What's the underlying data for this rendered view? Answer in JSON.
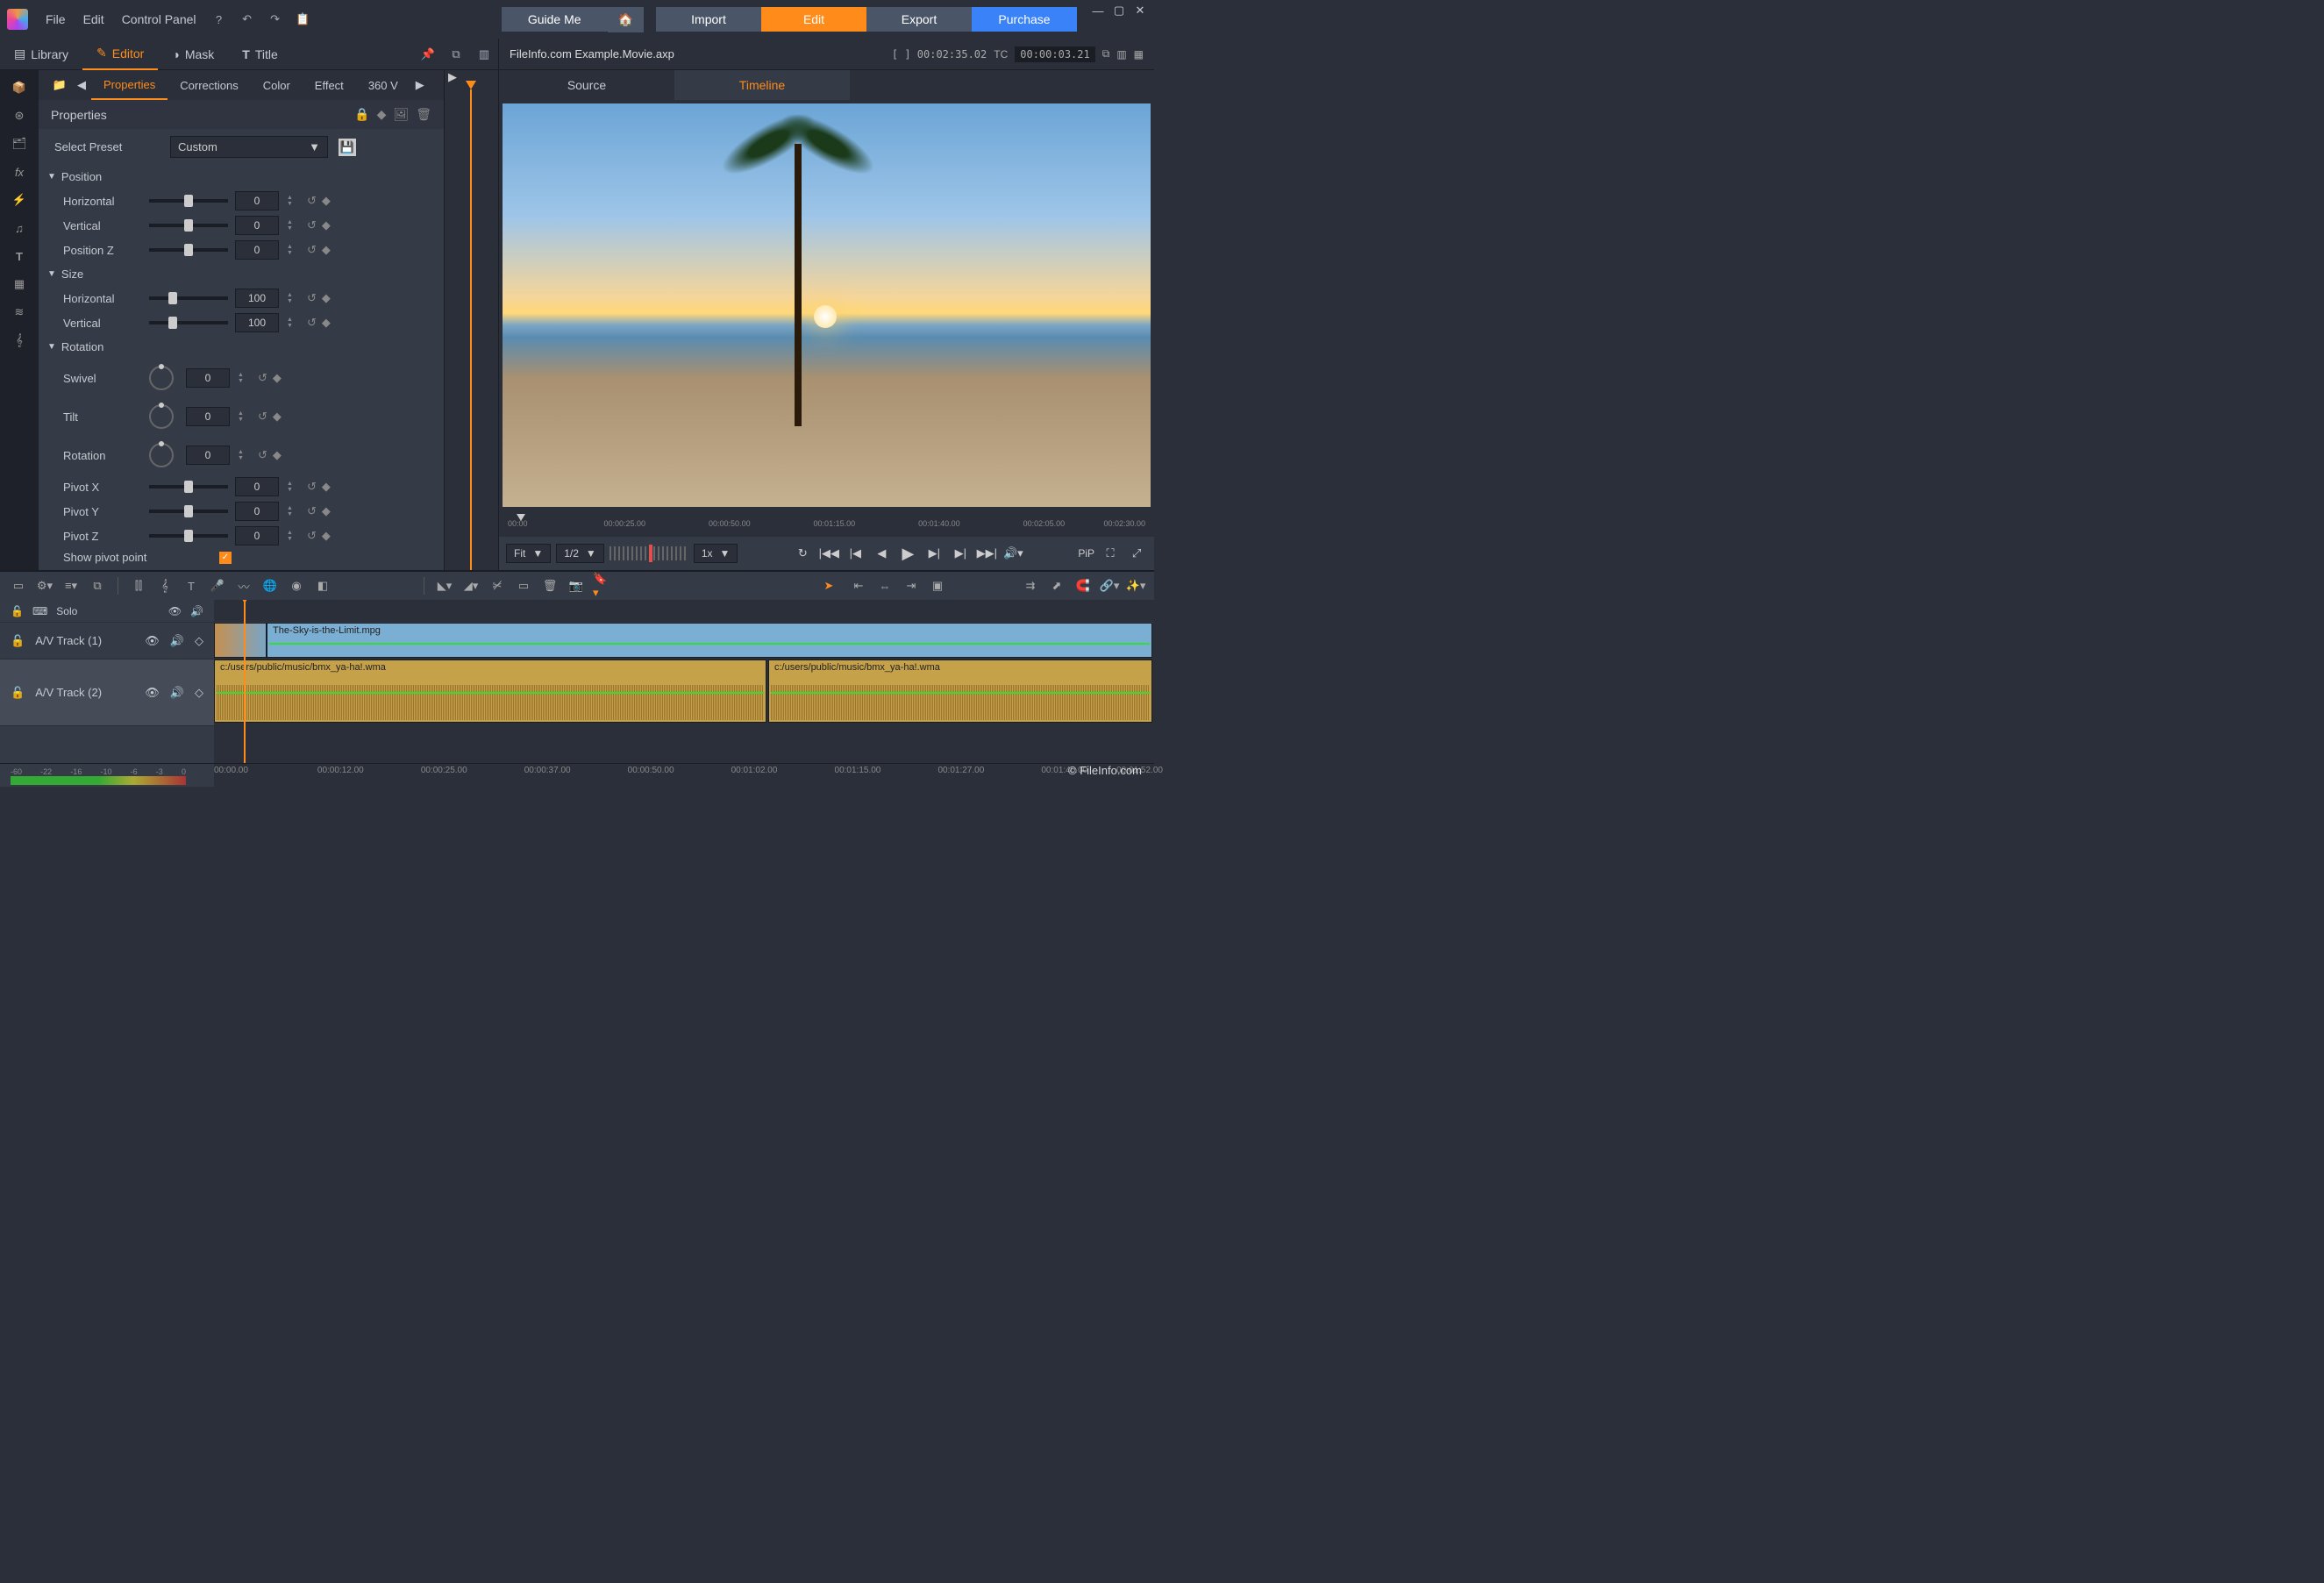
{
  "menus": {
    "file": "File",
    "edit": "Edit",
    "control_panel": "Control Panel"
  },
  "top_buttons": {
    "guide": "Guide Me",
    "import": "Import",
    "edit": "Edit",
    "export": "Export",
    "purchase": "Purchase"
  },
  "main_tabs": {
    "library": "Library",
    "editor": "Editor",
    "mask": "Mask",
    "title": "Title"
  },
  "sub_tabs": {
    "properties": "Properties",
    "corrections": "Corrections",
    "color": "Color",
    "effect": "Effect",
    "360": "360 V"
  },
  "panel": {
    "header": "Properties",
    "preset_label": "Select Preset",
    "preset_value": "Custom",
    "groups": {
      "position": "Position",
      "size": "Size",
      "rotation": "Rotation"
    },
    "rows": {
      "horizontal": "Horizontal",
      "vertical": "Vertical",
      "position_z": "Position Z",
      "size_h": "Horizontal",
      "size_v": "Vertical",
      "swivel": "Swivel",
      "tilt": "Tilt",
      "rotation": "Rotation",
      "pivot_x": "Pivot X",
      "pivot_y": "Pivot Y",
      "pivot_z": "Pivot Z",
      "show_pivot": "Show pivot point"
    },
    "vals": {
      "horizontal": "0",
      "vertical": "0",
      "position_z": "0",
      "size_h": "100",
      "size_v": "100",
      "swivel": "0",
      "tilt": "0",
      "rotation": "0",
      "pivot_x": "0",
      "pivot_y": "0",
      "pivot_z": "0"
    }
  },
  "preview": {
    "filename": "FileInfo.com Example.Movie.axp",
    "tc_in": "[ ] 00:02:35.02",
    "tc_label": "TC",
    "tc_out": "00:00:03.21",
    "tabs": {
      "source": "Source",
      "timeline": "Timeline"
    },
    "ticks": [
      "00:00",
      "00:00:25.00",
      "00:00:50.00",
      "00:01:15.00",
      "00:01:40.00",
      "00:02:05.00",
      "00:02:30.00"
    ],
    "fit": "Fit",
    "half": "1/2",
    "speed": "1x",
    "pip": "PiP"
  },
  "timeline": {
    "solo": "Solo",
    "track1": "A/V Track (1)",
    "track2": "A/V Track (2)",
    "clip_video": "The-Sky-is-the-Limit.mpg",
    "clip_audio": "c:/users/public/music/bmx_ya-ha!.wma",
    "ruler": [
      "00:00.00",
      "00:00:12.00",
      "00:00:25.00",
      "00:00:37.00",
      "00:00:50.00",
      "00:01:02.00",
      "00:01:15.00",
      "00:01:27.00",
      "00:01:40.00",
      "00:01:52.00"
    ],
    "meter": [
      "-60",
      "-22",
      "-16",
      "-10",
      "-6",
      "-3",
      "0"
    ]
  },
  "watermark": "© FileInfo.com"
}
